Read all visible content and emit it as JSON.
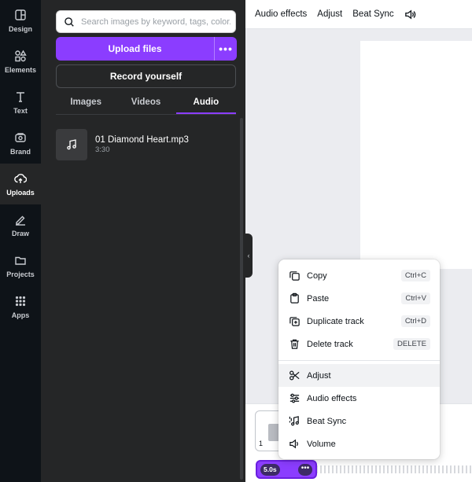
{
  "rail": [
    {
      "label": "Design",
      "icon": "design-icon"
    },
    {
      "label": "Elements",
      "icon": "elements-icon"
    },
    {
      "label": "Text",
      "icon": "text-icon"
    },
    {
      "label": "Brand",
      "icon": "brand-icon"
    },
    {
      "label": "Uploads",
      "icon": "uploads-icon",
      "active": true
    },
    {
      "label": "Draw",
      "icon": "draw-icon"
    },
    {
      "label": "Projects",
      "icon": "projects-icon"
    },
    {
      "label": "Apps",
      "icon": "apps-icon"
    }
  ],
  "panel": {
    "search_placeholder": "Search images by keyword, tags, color...",
    "upload_label": "Upload files",
    "upload_more": "•••",
    "record_label": "Record yourself",
    "tabs": [
      {
        "label": "Images"
      },
      {
        "label": "Videos"
      },
      {
        "label": "Audio",
        "active": true
      }
    ],
    "audio_items": [
      {
        "name": "01 Diamond Heart.mp3",
        "duration": "3:30"
      }
    ]
  },
  "topbar": {
    "audio_effects": "Audio effects",
    "adjust": "Adjust",
    "beat_sync": "Beat Sync",
    "volume_icon": "volume-icon"
  },
  "timeline": {
    "page_number": "1",
    "track_duration": "5.0s",
    "track_more": "•••"
  },
  "context_menu": {
    "items": [
      {
        "label": "Copy",
        "shortcut": "Ctrl+C",
        "icon": "copy-icon"
      },
      {
        "label": "Paste",
        "shortcut": "Ctrl+V",
        "icon": "paste-icon"
      },
      {
        "label": "Duplicate track",
        "shortcut": "Ctrl+D",
        "icon": "duplicate-icon"
      },
      {
        "label": "Delete track",
        "shortcut": "DELETE",
        "icon": "trash-icon"
      },
      {
        "label": "Adjust",
        "icon": "scissors-icon",
        "highlighted": true
      },
      {
        "label": "Audio effects",
        "icon": "sliders-icon"
      },
      {
        "label": "Beat Sync",
        "icon": "beat-sync-icon"
      },
      {
        "label": "Volume",
        "icon": "volume-icon"
      }
    ]
  },
  "colors": {
    "accent": "#8b3dff",
    "rail_bg": "#0e1318",
    "panel_bg": "#252627",
    "canvas_bg": "#ebecf0"
  }
}
